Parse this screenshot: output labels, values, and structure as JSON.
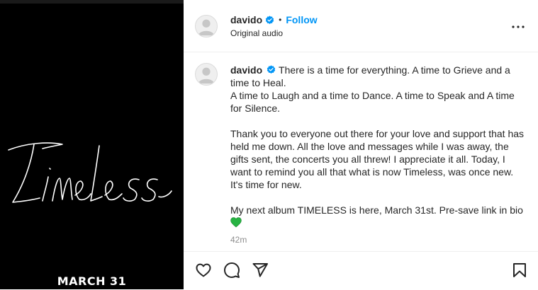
{
  "media": {
    "title_script": "Timeless",
    "date_text": "MARCH 31"
  },
  "post": {
    "username": "davido",
    "follow_label": "Follow",
    "separator": "•",
    "audio_label": "Original audio"
  },
  "caption": {
    "username": "davido",
    "body": "There is a time for everything. A time to Grieve and a time to Heal.\nA time to Laugh and a time to Dance. A time to Speak and A time for Silence.\n\nThank you to everyone out there for your love and support that has held me down. All the love and messages while I was away, the gifts sent, the concerts you all threw! I appreciate it all. Today, I want to remind you all that what is now Timeless, was once new. It's time for new.\n\nMy next album TIMELESS is here, March 31st. Pre-save link in bio ",
    "emoji": "green-heart",
    "timestamp": "42m"
  },
  "actions": [
    "like",
    "comment",
    "share",
    "save"
  ],
  "colors": {
    "accent": "#0095f6",
    "verified": "#0095f6",
    "emoji_green": "#27b343",
    "media_bg": "#000000"
  }
}
